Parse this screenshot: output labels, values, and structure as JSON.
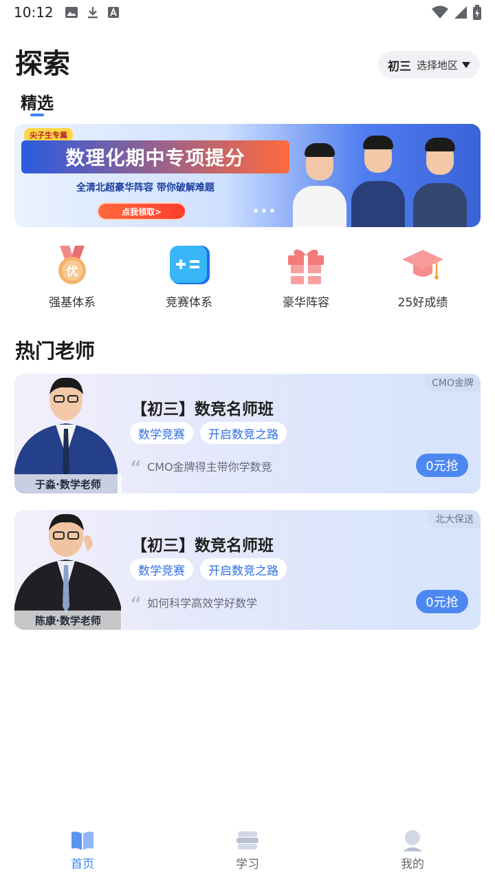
{
  "status_bar": {
    "time": "10:12"
  },
  "header": {
    "title": "探索",
    "region": {
      "grade": "初三",
      "label": "选择地区"
    }
  },
  "tabs": {
    "featured": "精选"
  },
  "banner": {
    "tag": "尖子生专属",
    "headline": "数理化期中专项提分",
    "subline": "全清北超豪华阵容 带你破解难题",
    "cta": "点我领取>"
  },
  "quick_entries": [
    {
      "label": "强基体系",
      "icon": "medal-icon"
    },
    {
      "label": "竞赛体系",
      "icon": "calculator-icon"
    },
    {
      "label": "豪华阵容",
      "icon": "gift-icon"
    },
    {
      "label": "25好成绩",
      "icon": "graduation-cap-icon"
    }
  ],
  "section": {
    "hot_teachers": "热门老师"
  },
  "teachers": [
    {
      "badge": "CMO金牌",
      "name": "于淼·数学老师",
      "title": "【初三】数竞名师班",
      "tags": [
        "数学竞赛",
        "开启数竞之路"
      ],
      "quote": "CMO金牌得主带你学数竞",
      "cta": "0元抢"
    },
    {
      "badge": "北大保送",
      "name": "陈康·数学老师",
      "title": "【初三】数竞名师班",
      "tags": [
        "数学竞赛",
        "开启数竞之路"
      ],
      "quote": "如何科学高效学好数学",
      "cta": "0元抢"
    }
  ],
  "bottom_nav": [
    {
      "label": "首页",
      "active": true
    },
    {
      "label": "学习",
      "active": false
    },
    {
      "label": "我的",
      "active": false
    }
  ],
  "colors": {
    "accent": "#3b82f6",
    "cta": "#4d88f0"
  }
}
